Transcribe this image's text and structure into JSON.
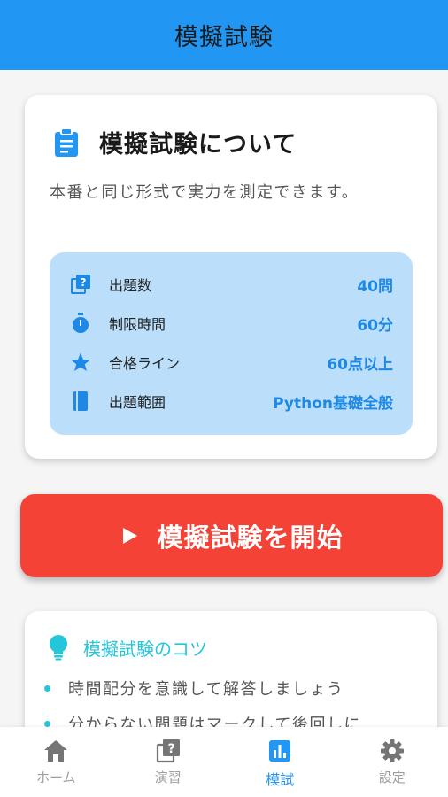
{
  "appbar": {
    "title": "模擬試験"
  },
  "info": {
    "title": "模擬試験について",
    "description": "本番と同じ形式で実力を測定できます。",
    "details": [
      {
        "icon": "quiz-icon",
        "label": "出題数",
        "value": "40問"
      },
      {
        "icon": "timer-icon",
        "label": "制限時間",
        "value": "60分"
      },
      {
        "icon": "star-icon",
        "label": "合格ライン",
        "value": "60点以上"
      },
      {
        "icon": "book-icon",
        "label": "出題範囲",
        "value": "Python基礎全般"
      }
    ]
  },
  "start_button": {
    "label": "模擬試験を開始"
  },
  "tips": {
    "title": "模擬試験のコツ",
    "items": [
      "時間配分を意識して解答しましょう",
      "分からない問題はマークして後回しに"
    ]
  },
  "nav": [
    {
      "label": "ホーム",
      "icon": "home-icon"
    },
    {
      "label": "演習",
      "icon": "quiz-icon"
    },
    {
      "label": "模試",
      "icon": "bar-chart-icon",
      "active": true
    },
    {
      "label": "設定",
      "icon": "gear-icon"
    }
  ],
  "colors": {
    "primary": "#2196f3",
    "accent_red": "#f44336",
    "detail_bg": "#bbdefb",
    "tip_cyan": "#26c6da"
  }
}
